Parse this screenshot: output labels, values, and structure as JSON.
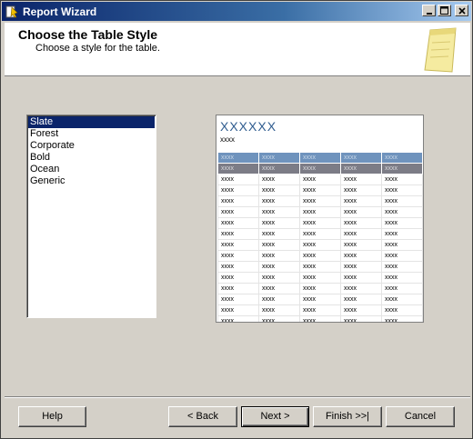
{
  "window": {
    "title": "Report Wizard"
  },
  "header": {
    "title": "Choose the Table Style",
    "subtitle": "Choose a style for the table."
  },
  "styles": {
    "items": [
      "Slate",
      "Forest",
      "Corporate",
      "Bold",
      "Ocean",
      "Generic"
    ],
    "selected": "Slate"
  },
  "preview": {
    "title": "XXXXXX",
    "subtitle": "xxxx",
    "cell_text": "xxxx",
    "rows": 16,
    "cols": 5,
    "colors": {
      "header": "#6f93bd",
      "group": "#7c7c86",
      "title": "#2f5c8f"
    }
  },
  "buttons": {
    "help": "Help",
    "back": "< Back",
    "next": "Next >",
    "finish": "Finish >>|",
    "cancel": "Cancel"
  }
}
